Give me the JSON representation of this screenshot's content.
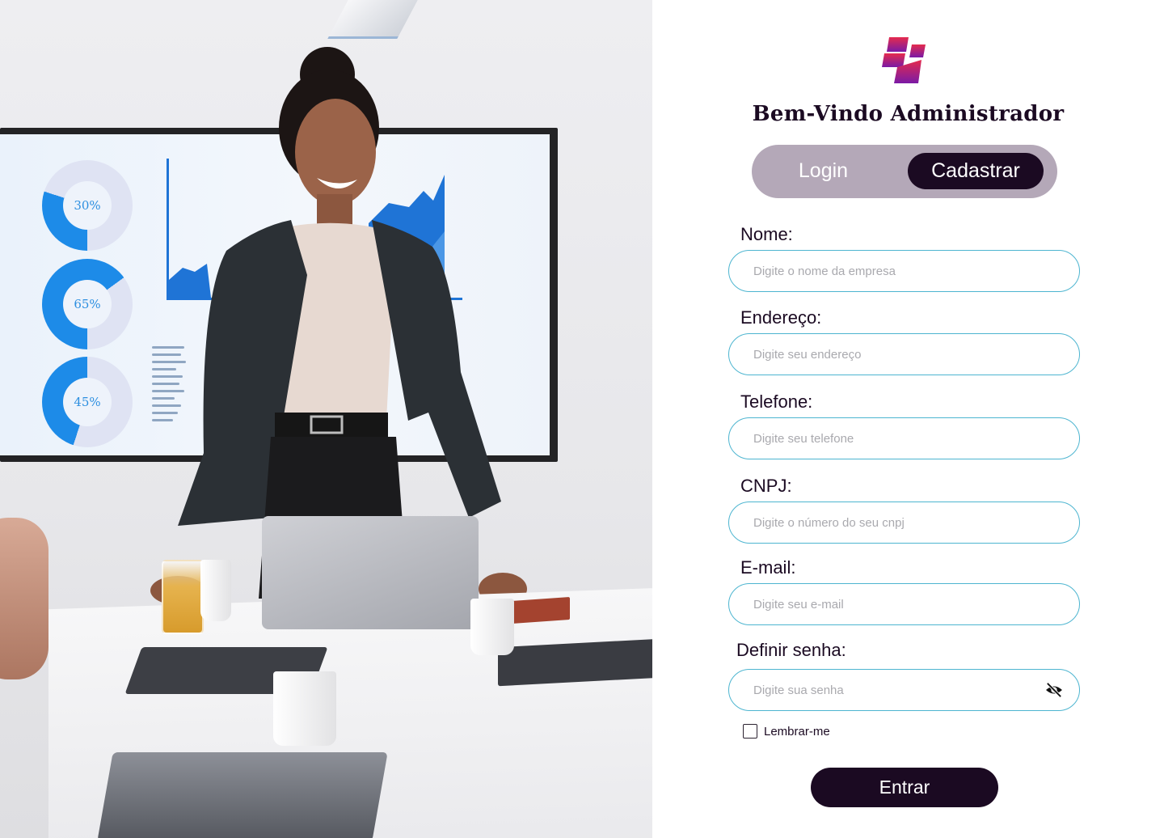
{
  "hero": {
    "image": "woman-presenting-in-meeting-room",
    "donuts": [
      "30%",
      "65%",
      "45%"
    ]
  },
  "brand": {
    "logo_icon": "brand-logo-icon",
    "colors": {
      "primary": "#1b0a22",
      "toggle_bg": "#b4a8b8",
      "field_border": "#4db5d0",
      "logo_top": "#e52b4d",
      "logo_bottom": "#7a1aa6"
    }
  },
  "header": {
    "welcome": "Bem-Vindo Administrador"
  },
  "tabs": {
    "login": "Login",
    "cadastrar": "Cadastrar",
    "active": "Cadastrar"
  },
  "form": {
    "nome": {
      "label": "Nome:",
      "placeholder": "Digite o nome da empresa"
    },
    "endereco": {
      "label": "Endereço:",
      "placeholder": "Digite seu endereço"
    },
    "telefone": {
      "label": "Telefone:",
      "placeholder": "Digite seu telefone"
    },
    "cnpj": {
      "label": "CNPJ:",
      "placeholder": "Digite o número do seu cnpj"
    },
    "email": {
      "label": "E-mail:",
      "placeholder": "Digite seu e-mail"
    },
    "senha": {
      "label": "Definir senha:",
      "placeholder": "Digite sua senha",
      "icon": "eye-slash-icon"
    },
    "remember": "Lembrar-me",
    "submit": "Entrar"
  }
}
